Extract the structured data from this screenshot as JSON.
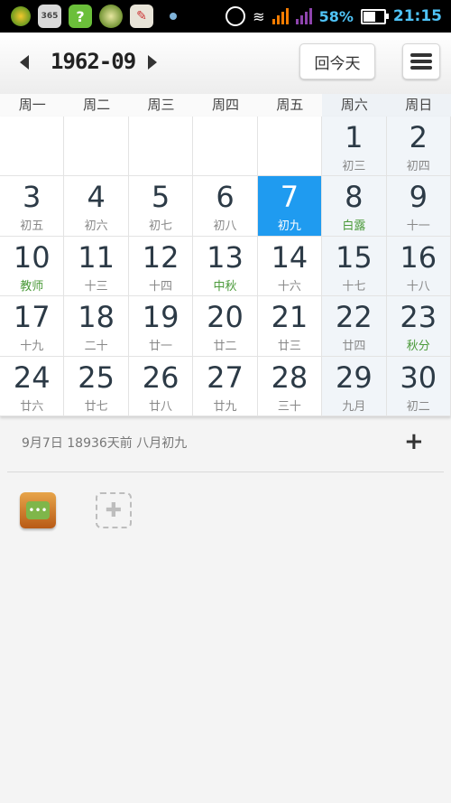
{
  "status_bar": {
    "icons": [
      "app-icon-1",
      "calendar-365-icon",
      "help-icon",
      "app-icon-4",
      "app-icon-5"
    ],
    "calendar_icon_text": "365",
    "battery_percent": "58%",
    "time": "21:15",
    "colors": {
      "accent": "#4fc3f7"
    }
  },
  "header": {
    "month_label": "1962-09",
    "today_button": "回今天"
  },
  "weekdays": [
    "周一",
    "周二",
    "周三",
    "周四",
    "周五",
    "周六",
    "周日"
  ],
  "calendar": {
    "selected_day": "7",
    "selected_color": "#1f9bf0",
    "cells": [
      {
        "day": "",
        "lunar": ""
      },
      {
        "day": "",
        "lunar": ""
      },
      {
        "day": "",
        "lunar": ""
      },
      {
        "day": "",
        "lunar": ""
      },
      {
        "day": "",
        "lunar": ""
      },
      {
        "day": "1",
        "lunar": "初三"
      },
      {
        "day": "2",
        "lunar": "初四"
      },
      {
        "day": "3",
        "lunar": "初五"
      },
      {
        "day": "4",
        "lunar": "初六"
      },
      {
        "day": "5",
        "lunar": "初七"
      },
      {
        "day": "6",
        "lunar": "初八"
      },
      {
        "day": "7",
        "lunar": "初九"
      },
      {
        "day": "8",
        "lunar": "白露",
        "festival": true
      },
      {
        "day": "9",
        "lunar": "十一"
      },
      {
        "day": "10",
        "lunar": "教师",
        "festival": true
      },
      {
        "day": "11",
        "lunar": "十三"
      },
      {
        "day": "12",
        "lunar": "十四"
      },
      {
        "day": "13",
        "lunar": "中秋",
        "festival": true
      },
      {
        "day": "14",
        "lunar": "十六"
      },
      {
        "day": "15",
        "lunar": "十七"
      },
      {
        "day": "16",
        "lunar": "十八"
      },
      {
        "day": "17",
        "lunar": "十九"
      },
      {
        "day": "18",
        "lunar": "二十"
      },
      {
        "day": "19",
        "lunar": "廿一"
      },
      {
        "day": "20",
        "lunar": "廿二"
      },
      {
        "day": "21",
        "lunar": "廿三"
      },
      {
        "day": "22",
        "lunar": "廿四"
      },
      {
        "day": "23",
        "lunar": "秋分",
        "festival": true
      },
      {
        "day": "24",
        "lunar": "廿六"
      },
      {
        "day": "25",
        "lunar": "廿七"
      },
      {
        "day": "26",
        "lunar": "廿八"
      },
      {
        "day": "27",
        "lunar": "廿九"
      },
      {
        "day": "28",
        "lunar": "三十"
      },
      {
        "day": "29",
        "lunar": "九月"
      },
      {
        "day": "30",
        "lunar": "初二"
      }
    ]
  },
  "info_bar": {
    "text": "9月7日 18936天前 八月初九",
    "add_label": "+"
  },
  "widgets": {
    "widget1_icon_text": "•••",
    "widget2_icon": "puzzle-icon"
  }
}
